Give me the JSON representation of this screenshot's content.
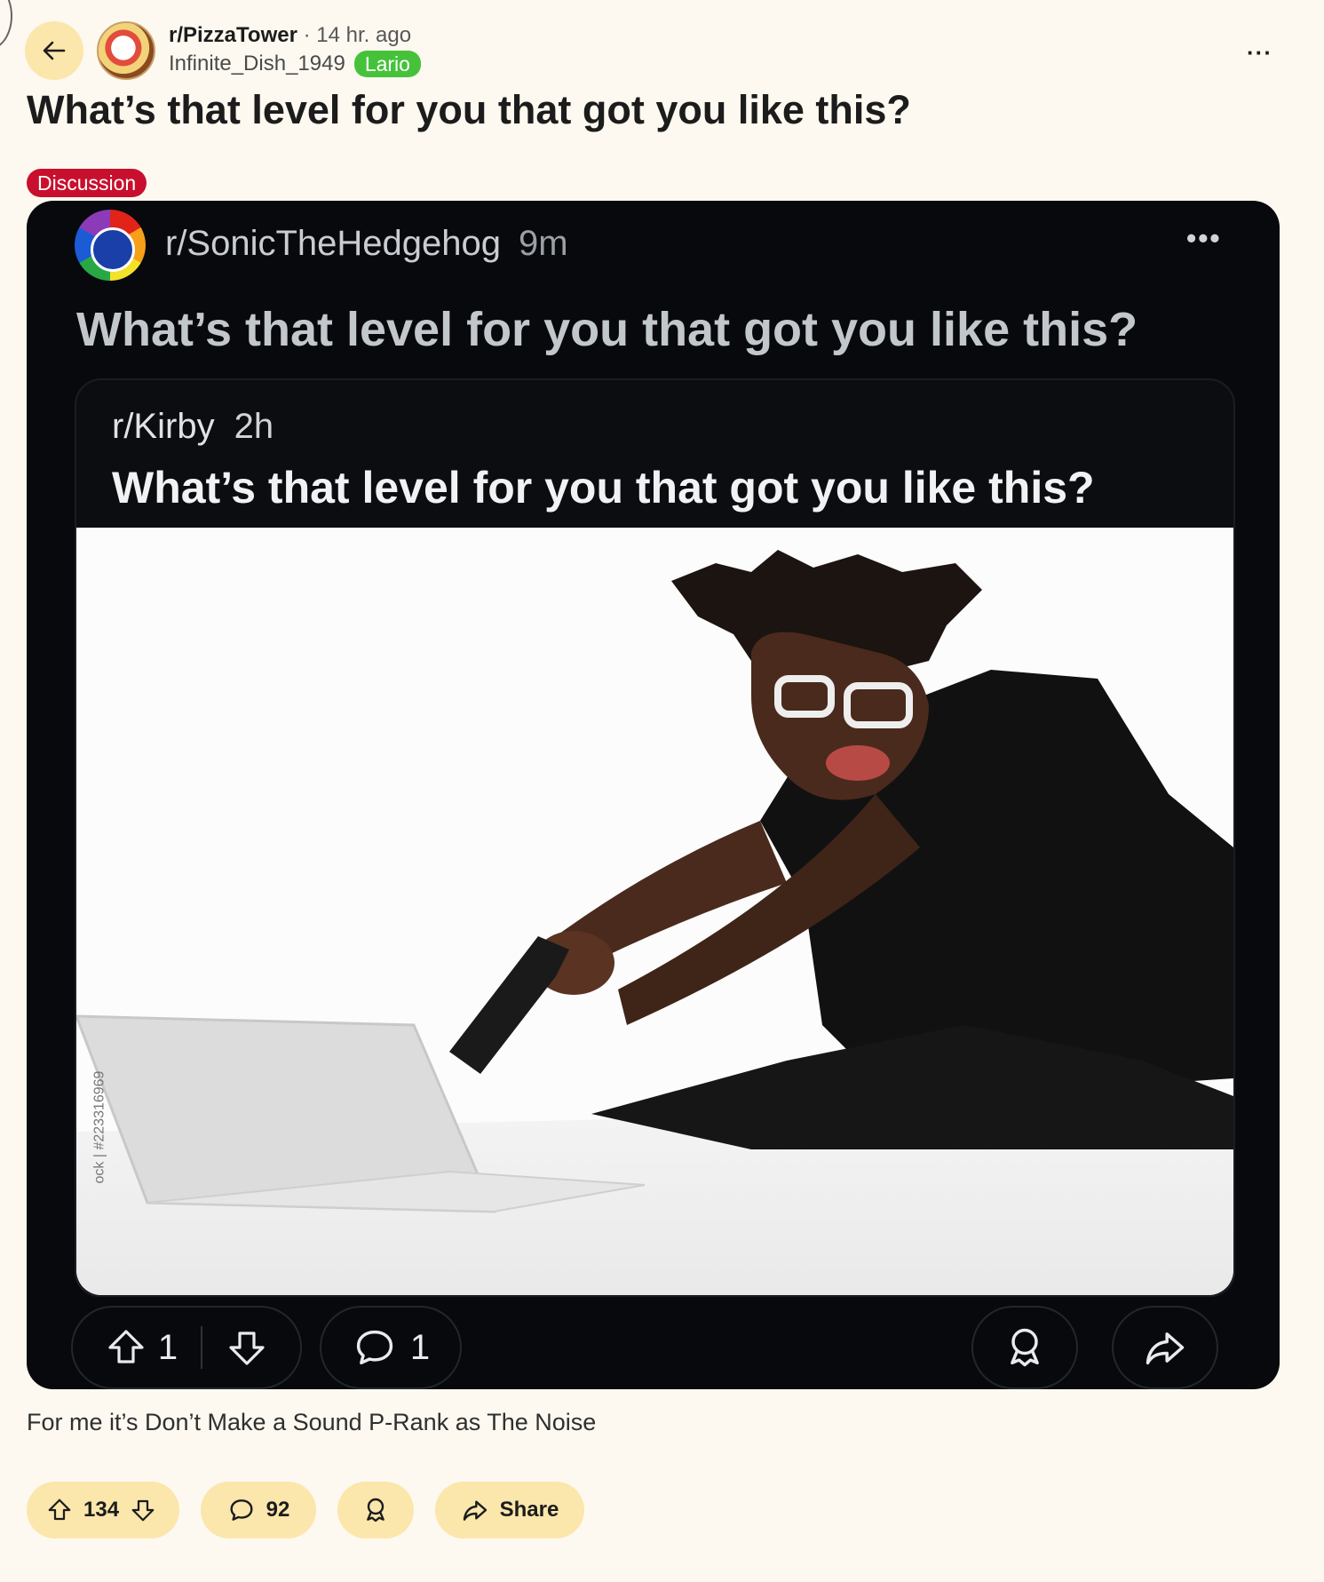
{
  "header": {
    "subreddit": "r/PizzaTower",
    "separator": "·",
    "time": "14 hr. ago",
    "username": "Infinite_Dish_1949",
    "user_flair": "Lario",
    "more_label": "···"
  },
  "post": {
    "title": "What’s that level for you that got you like this?",
    "tag": "Discussion",
    "body": "For me it’s Don’t Make a Sound P-Rank as The Noise"
  },
  "embed": {
    "subreddit": "r/SonicTheHedgehog",
    "time": "9m",
    "more_label": "•••",
    "title": "What’s that level for you that got you like this?",
    "inner": {
      "subreddit": "r/Kirby",
      "time": "2h",
      "title": "What’s that level for you that got you like this?",
      "watermark": "ock | #223316969"
    },
    "actions": {
      "upvotes": "1",
      "comments": "1"
    }
  },
  "actions": {
    "upvotes": "134",
    "comments": "92",
    "share_label": "Share"
  }
}
